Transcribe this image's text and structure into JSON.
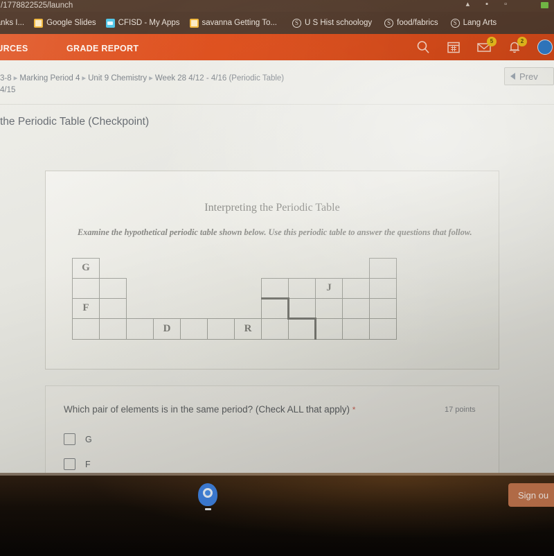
{
  "browser": {
    "url_fragment": "/1778822525/launch",
    "bookmarks": [
      {
        "label": "irbanks I...",
        "icon": "none"
      },
      {
        "label": "Google Slides",
        "icon": "doc-icon"
      },
      {
        "label": "CFISD - My Apps",
        "icon": "drive-icon"
      },
      {
        "label": "savanna Getting To...",
        "icon": "doc-icon"
      },
      {
        "label": "U S Hist schoology",
        "icon": "schoology-icon"
      },
      {
        "label": "food/fabrics",
        "icon": "schoology-icon"
      },
      {
        "label": "Lang Arts",
        "icon": "schoology-icon"
      }
    ]
  },
  "nav": {
    "links": [
      {
        "label": "ESOURCES"
      },
      {
        "label": "GRADE REPORT"
      }
    ],
    "icons": [
      {
        "name": "search-icon",
        "badge": ""
      },
      {
        "name": "calendar-icon",
        "badge": ""
      },
      {
        "name": "messages-icon",
        "badge": "5"
      },
      {
        "name": "notifications-icon",
        "badge": "2"
      },
      {
        "name": "avatar",
        "badge": ""
      }
    ]
  },
  "course": {
    "breadcrumb": [
      "3-8",
      "Marking Period 4",
      "Unit 9 Chemistry",
      "Week 28 4/12 - 4/16 (Periodic Table)"
    ],
    "due_date": "4/15",
    "prev_label": "Prev",
    "assignment_title": "the Periodic Table (Checkpoint)"
  },
  "worksheet": {
    "title": "Interpreting the Periodic Table",
    "instructions": "Examine the hypothetical periodic table shown below. Use this periodic table to answer the questions that follow.",
    "labeled_cells": [
      {
        "symbol": "G",
        "row": 1,
        "col": 1
      },
      {
        "symbol": "F",
        "row": 3,
        "col": 1
      },
      {
        "symbol": "D",
        "row": 4,
        "col": 4
      },
      {
        "symbol": "R",
        "row": 4,
        "col": 7
      },
      {
        "symbol": "J",
        "row": 2,
        "col": 10
      }
    ]
  },
  "question": {
    "prompt": "Which pair of elements is in the same period? (Check ALL that apply)",
    "required_marker": "*",
    "points": "17 points",
    "options": [
      {
        "label": "G",
        "checked": false
      },
      {
        "label": "F",
        "checked": false
      }
    ]
  },
  "shelf": {
    "launcher_icon": "chrome-icon",
    "sign_out_label": "Sign ou"
  },
  "colors": {
    "schoology_orange": "#dd4814",
    "browser_brown": "#4a3224",
    "paper": "#f3f2ec",
    "required_red": "#c0392b",
    "sign_out": "#c7784f"
  }
}
